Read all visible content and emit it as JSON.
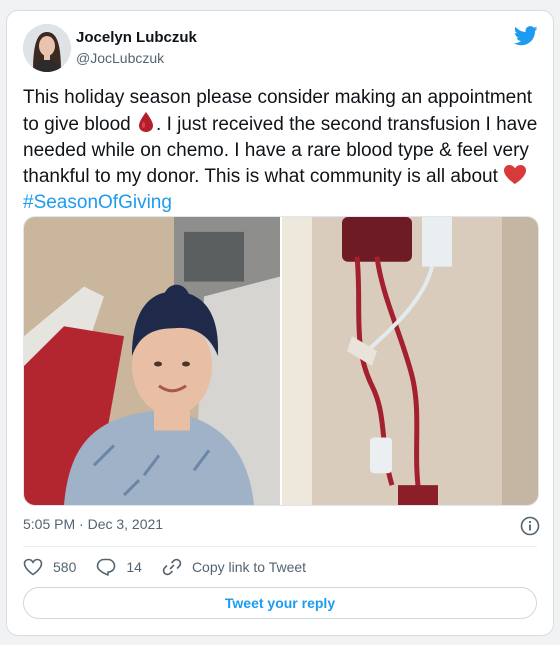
{
  "author": {
    "name": "Jocelyn Lubczuk",
    "handle": "@JocLubczuk"
  },
  "tweet": {
    "text_part1": "This holiday season please consider making an appointment to give blood",
    "text_part2": ". I just received the second transfusion I have needed while on chemo. I have a rare blood type & feel very thankful to my donor. This is what community is all about",
    "hashtag": "#SeasonOfGiving",
    "emojis": [
      "blood-drop-icon",
      "red-heart-icon"
    ]
  },
  "media": {
    "photos": [
      "hospital-selfie-photo",
      "blood-transfusion-bag-photo"
    ]
  },
  "meta": {
    "timestamp": "5:05 PM · Dec 3, 2021"
  },
  "actions": {
    "like_count": "580",
    "reply_count": "14",
    "copy_link_label": "Copy link to Tweet"
  },
  "reply_button": {
    "label": "Tweet your reply"
  },
  "colors": {
    "accent": "#1d9bf0",
    "text": "#0f1419",
    "secondary": "#536471"
  }
}
